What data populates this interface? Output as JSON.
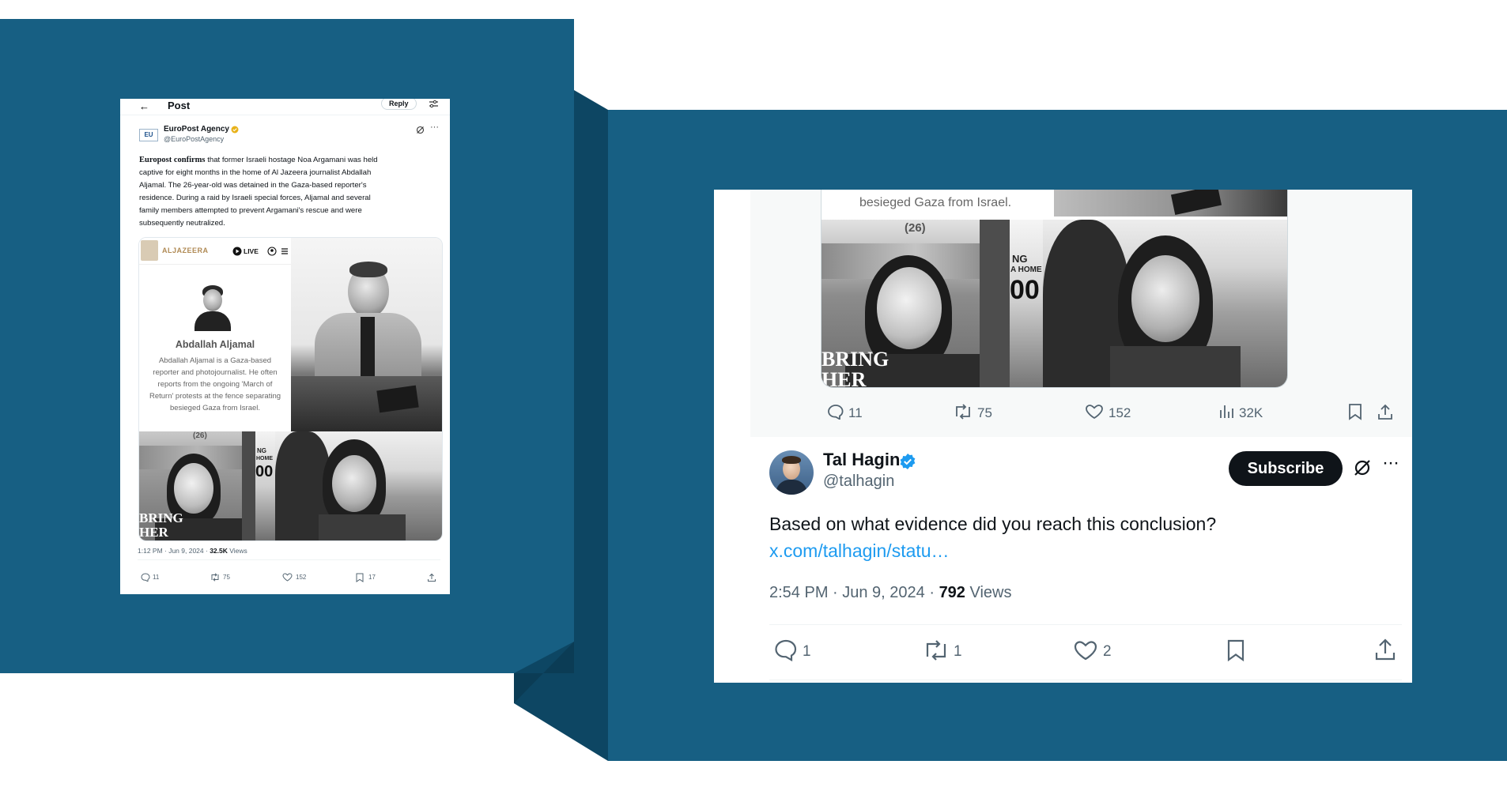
{
  "left_tweet": {
    "header_title": "Post",
    "reply_label": "Reply",
    "author_name": "EuroPost Agency",
    "author_handle": "@EuroPostAgency",
    "avatar_text": "EU",
    "body_lead": "Europost confirms",
    "body_lines": [
      " that former Israeli hostage Noa Argamani was held",
      "captive for eight months in the home of Al Jazeera journalist Abdallah",
      "Aljamal. The 26-year-old was detained in the Gaza-based reporter's",
      "residence. During a raid by Israeli special forces, Aljamal and several",
      "family members attempted to prevent Argamani's rescue and were",
      "subsequently neutralized."
    ],
    "embed": {
      "brand": "ALJAZEERA",
      "live_label": "LIVE",
      "person_name": "Abdallah Aljamal",
      "bio_lines": [
        "Abdallah Aljamal is a Gaza-based",
        "reporter and photojournalist. He often",
        "reports from the ongoing 'March of",
        "Return' protests at the fence separating",
        "besieged Gaza from Israel."
      ],
      "poster_number": "(26)",
      "poster_text_1": "BRING",
      "poster_text_2": "HER",
      "poster_side": "NG",
      "poster_side2": "HOME",
      "poster_side3": "00"
    },
    "time": "1:12 PM · Jun 9, 2024 · ",
    "views_count": "32.5K",
    "views_label": " Views",
    "stats": {
      "replies": "11",
      "reposts": "75",
      "likes": "152",
      "bookmarks": "17"
    }
  },
  "right_tweet": {
    "caption": "besieged Gaza from Israel.",
    "poster_number": "(26)",
    "poster_text_1": "BRING",
    "poster_text_2": "HER",
    "poster_side": "NG",
    "poster_side2": "A HOME",
    "poster_side3": "00",
    "quoted_stats": {
      "replies": "11",
      "reposts": "75",
      "likes": "152",
      "views": "32K"
    },
    "author_name": "Tal Hagin",
    "author_handle": "@talhagin",
    "subscribe_label": "Subscribe",
    "text": "Based on what evidence did you reach this conclusion?",
    "link": "x.com/talhagin/statu…",
    "time": "2:54 PM · Jun 9, 2024 · ",
    "views_count": "792",
    "views_label": " Views",
    "stats": {
      "replies": "1",
      "reposts": "1",
      "likes": "2"
    }
  },
  "colors": {
    "panel": "#175f83",
    "panel_dark": "#0d4663",
    "link": "#1d9bf0",
    "verified": "#1d9bf0",
    "gold_badge": "#e8b21a"
  }
}
